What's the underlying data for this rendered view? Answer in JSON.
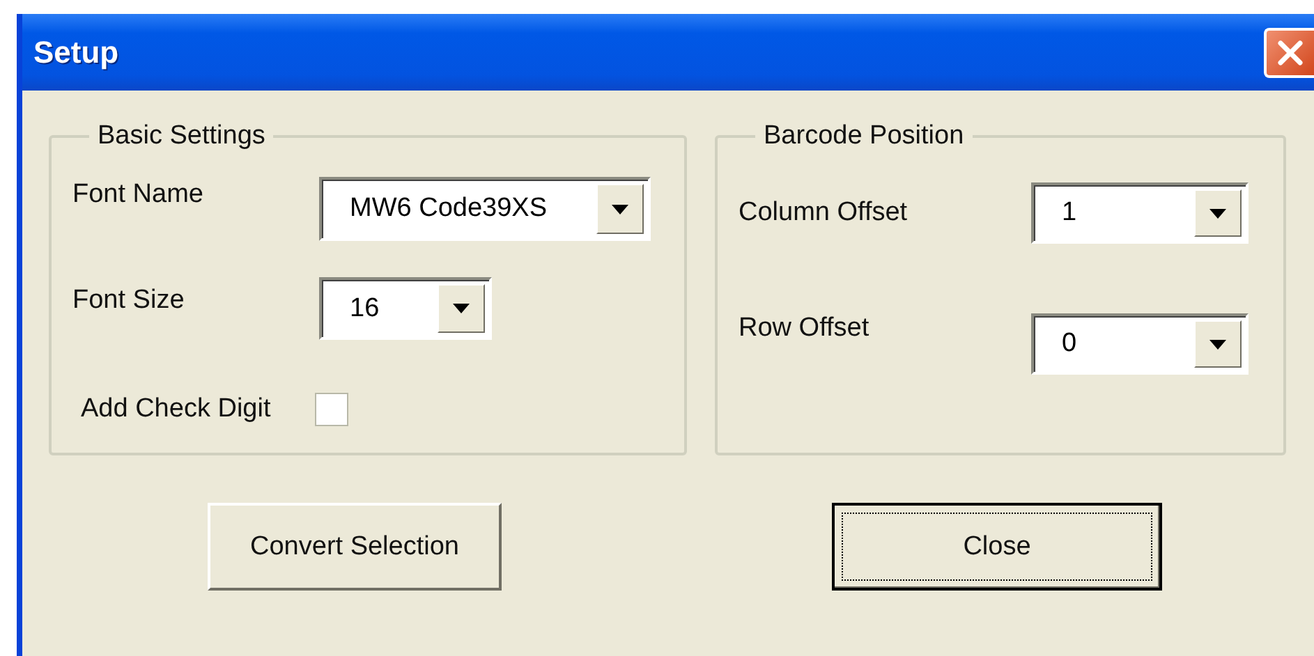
{
  "window": {
    "title": "Setup"
  },
  "groups": [
    {
      "title": "Basic Settings",
      "fields": [
        {
          "kind": "combo",
          "label": "Font Name",
          "value": "MW6 Code39XS"
        },
        {
          "kind": "combo",
          "label": "Font Size",
          "value": "16"
        },
        {
          "kind": "checkbox",
          "label": "Add Check Digit",
          "checked": false
        }
      ]
    },
    {
      "title": "Barcode Position",
      "fields": [
        {
          "kind": "combo",
          "label": "Column Offset",
          "value": "1"
        },
        {
          "kind": "combo",
          "label": "Row Offset",
          "value": "0"
        }
      ]
    }
  ],
  "buttons": [
    {
      "label": "Convert Selection",
      "focused": false
    },
    {
      "label": "Close",
      "focused": true
    }
  ]
}
